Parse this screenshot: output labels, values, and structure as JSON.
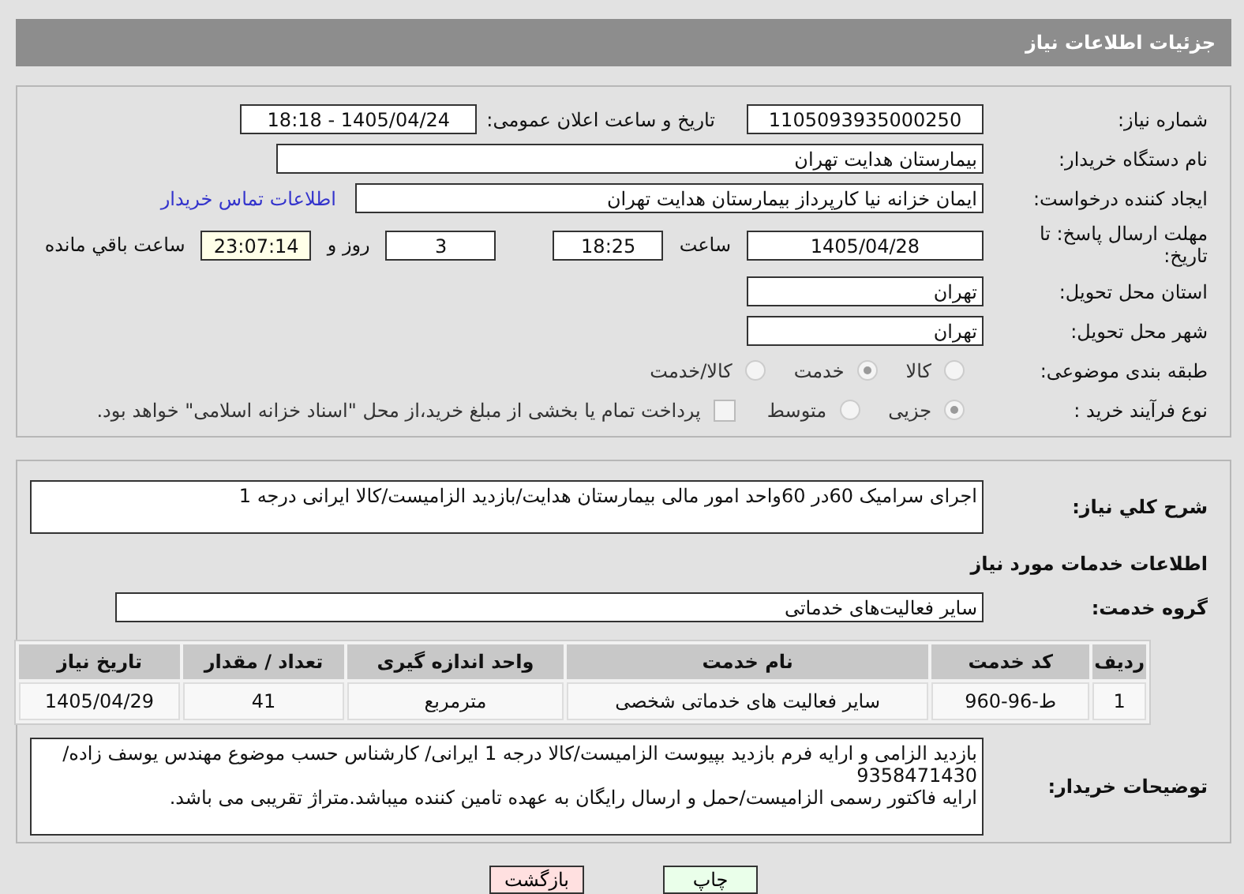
{
  "header": {
    "title": "جزئیات اطلاعات نیاز"
  },
  "need_number": {
    "label": "شماره نیاز:",
    "value": "1105093935000250"
  },
  "announce": {
    "label": "تاریخ و ساعت اعلان عمومی:",
    "value": "1405/04/24 - 18:18"
  },
  "buyer": {
    "label": "نام دستگاه خریدار:",
    "value": "بیمارستان هدایت تهران"
  },
  "creator": {
    "label": "ایجاد کننده درخواست:",
    "value": "ایمان خزانه نیا کارپرداز بیمارستان هدایت تهران",
    "link": "اطلاعات تماس خریدار"
  },
  "deadline": {
    "label": "مهلت ارسال پاسخ: تا تاریخ:",
    "date": "1405/04/28",
    "time_label": "ساعت",
    "time": "18:25",
    "days": "3",
    "days_label": "روز و",
    "remaining": "23:07:14",
    "remaining_label": "ساعت باقي مانده"
  },
  "province": {
    "label": "استان محل تحویل:",
    "value": "تهران"
  },
  "city": {
    "label": "شهر محل تحویل:",
    "value": "تهران"
  },
  "category": {
    "label": "طبقه بندی موضوعی:",
    "options": [
      {
        "label": "کالا",
        "selected": false
      },
      {
        "label": "خدمت",
        "selected": true
      },
      {
        "label": "کالا/خدمت",
        "selected": false
      }
    ]
  },
  "process": {
    "label": "نوع فرآیند خرید :",
    "options": [
      {
        "label": "جزیی",
        "selected": true
      },
      {
        "label": "متوسط",
        "selected": false
      }
    ],
    "payment": {
      "checked": false,
      "label": "پرداخت تمام یا بخشی از مبلغ خرید،از محل \"اسناد خزانه اسلامی\" خواهد بود."
    }
  },
  "description": {
    "label": "شرح کلي نیاز:",
    "value": "اجرای سرامیک 60در 60واحد امور مالی بیمارستان هدایت/بازدید الزامیست/کالا ایرانی درجه 1"
  },
  "services_title": "اطلاعات خدمات مورد نیاز",
  "service_group": {
    "label": "گروه خدمت:",
    "value": "سایر فعالیت‌های خدماتی"
  },
  "table": {
    "columns": [
      "ردیف",
      "کد خدمت",
      "نام خدمت",
      "واحد اندازه گیری",
      "تعداد / مقدار",
      "تاریخ نیاز"
    ],
    "rows": [
      [
        "1",
        "ط-96-960",
        "سایر فعالیت های خدماتی شخصی",
        "مترمربع",
        "41",
        "1405/04/29"
      ]
    ]
  },
  "buyer_notes": {
    "label": "توضیحات خریدار:",
    "lines": [
      "بازدید الزامی و ارایه فرم بازدید بپیوست الزامیست/کالا درجه 1 ایرانی/ کارشناس حسب موضوع مهندس یوسف زاده/",
      "9358471430",
      "ارایه فاکتور رسمی الزامیست/حمل و ارسال رایگان به عهده تامین کننده میباشد.متراژ تقریبی می باشد."
    ]
  },
  "buttons": [
    {
      "label": "چاپ",
      "kind": "print"
    },
    {
      "label": "بازگشت",
      "kind": "back"
    }
  ]
}
